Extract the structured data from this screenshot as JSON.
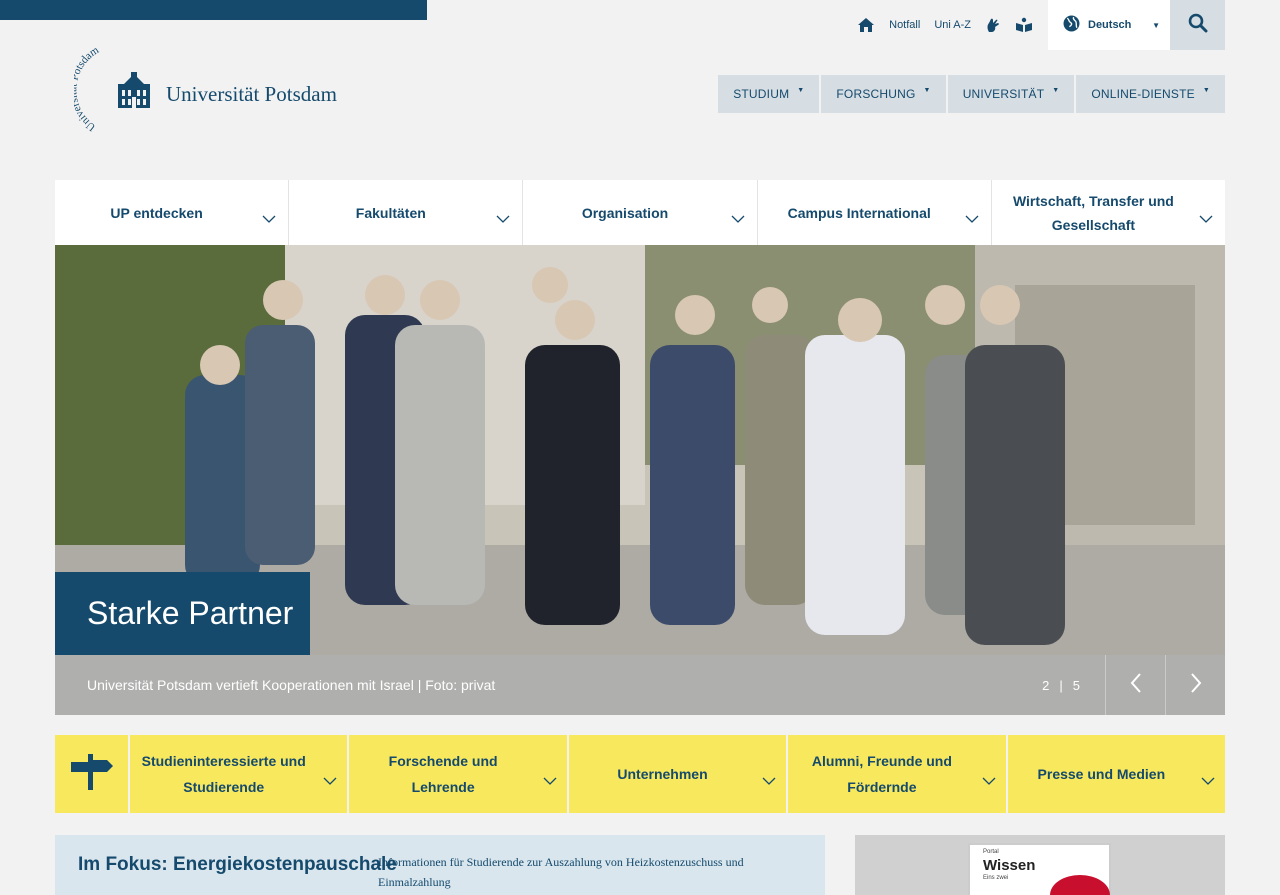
{
  "service": {
    "home_icon": "home-icon",
    "links": [
      "Notfall",
      "Uni A-Z"
    ],
    "sign_language_icon": "sign-language-icon",
    "easy_language_icon": "easy-language-icon",
    "language": "Deutsch",
    "search_icon": "search-icon"
  },
  "logo": {
    "title": "Universität Potsdam",
    "seal_text": "Universität Potsdam"
  },
  "main_nav": [
    "STUDIUM",
    "FORSCHUNG",
    "UNIVERSITÄT",
    "ONLINE-DIENSTE"
  ],
  "sub_nav": [
    "UP entdecken",
    "Fakultäten",
    "Organisation",
    "Campus International",
    "Wirtschaft, Transfer und Gesellschaft"
  ],
  "hero": {
    "title": "Starke Partner",
    "caption": "Universität Potsdam vertieft Kooperationen mit Israel | Foto: privat",
    "current": "2",
    "separator": "|",
    "total": "5"
  },
  "target_nav": [
    "Studieninteressierte und Studierende",
    "Forschende und Lehrende",
    "Unternehmen",
    "Alumni, Freunde und Fördernde",
    "Presse und Medien"
  ],
  "focus": {
    "title": "Im Fokus: Energiekostenpauschale",
    "text": "Informationen für Studierende zur Auszahlung von Heizkostenzuschuss und Einmalzahlung"
  },
  "teaser": {
    "small": "Portal",
    "word": "Wissen",
    "sub": "Eins zwei"
  },
  "colors": {
    "primary": "#154a6d",
    "accent_yellow": "#f7e85e",
    "light_blue": "#d9e6ee",
    "nav_grey": "#d6dde3"
  }
}
